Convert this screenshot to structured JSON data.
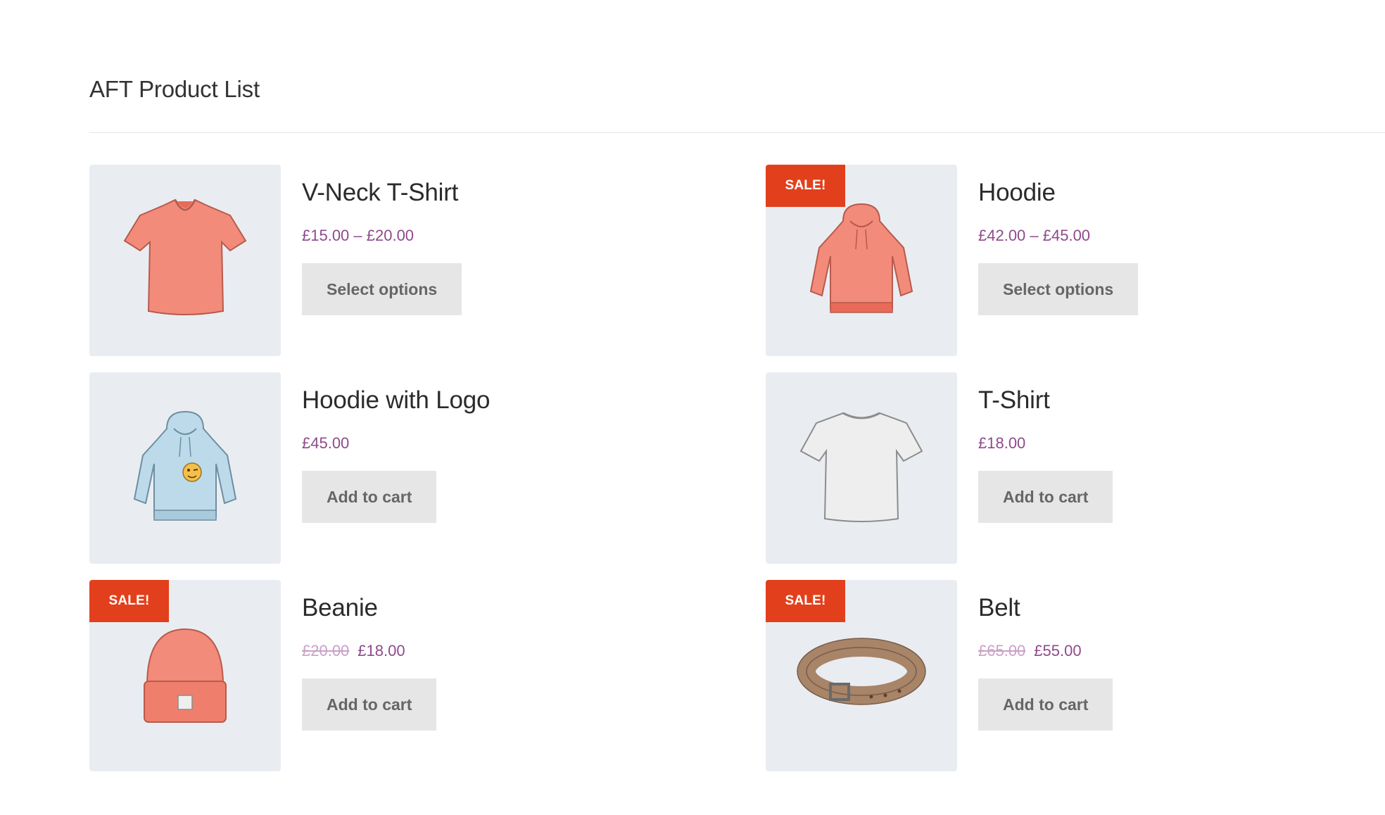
{
  "page": {
    "heading": "AFT Product List"
  },
  "colors": {
    "sale_badge": "#e2401c",
    "price": "#8e4a8c",
    "button_bg": "#e6e6e6",
    "thumb_bg": "#e9edf2"
  },
  "products": [
    {
      "name": "V-Neck T-Shirt",
      "price": "£15.00 – £20.00",
      "old_price": "",
      "sale_badge": "",
      "button": "Select options",
      "icon": "vneck-tshirt-icon"
    },
    {
      "name": "Hoodie",
      "price": "£42.00 – £45.00",
      "old_price": "",
      "sale_badge": "SALE!",
      "button": "Select options",
      "icon": "hoodie-icon"
    },
    {
      "name": "Hoodie with Logo",
      "price": "£45.00",
      "old_price": "",
      "sale_badge": "",
      "button": "Add to cart",
      "icon": "hoodie-with-logo-icon"
    },
    {
      "name": "T-Shirt",
      "price": "£18.00",
      "old_price": "",
      "sale_badge": "",
      "button": "Add to cart",
      "icon": "tshirt-icon"
    },
    {
      "name": "Beanie",
      "price": "£18.00",
      "old_price": "£20.00",
      "sale_badge": "SALE!",
      "button": "Add to cart",
      "icon": "beanie-icon"
    },
    {
      "name": "Belt",
      "price": "£55.00",
      "old_price": "£65.00",
      "sale_badge": "SALE!",
      "button": "Add to cart",
      "icon": "belt-icon"
    }
  ]
}
